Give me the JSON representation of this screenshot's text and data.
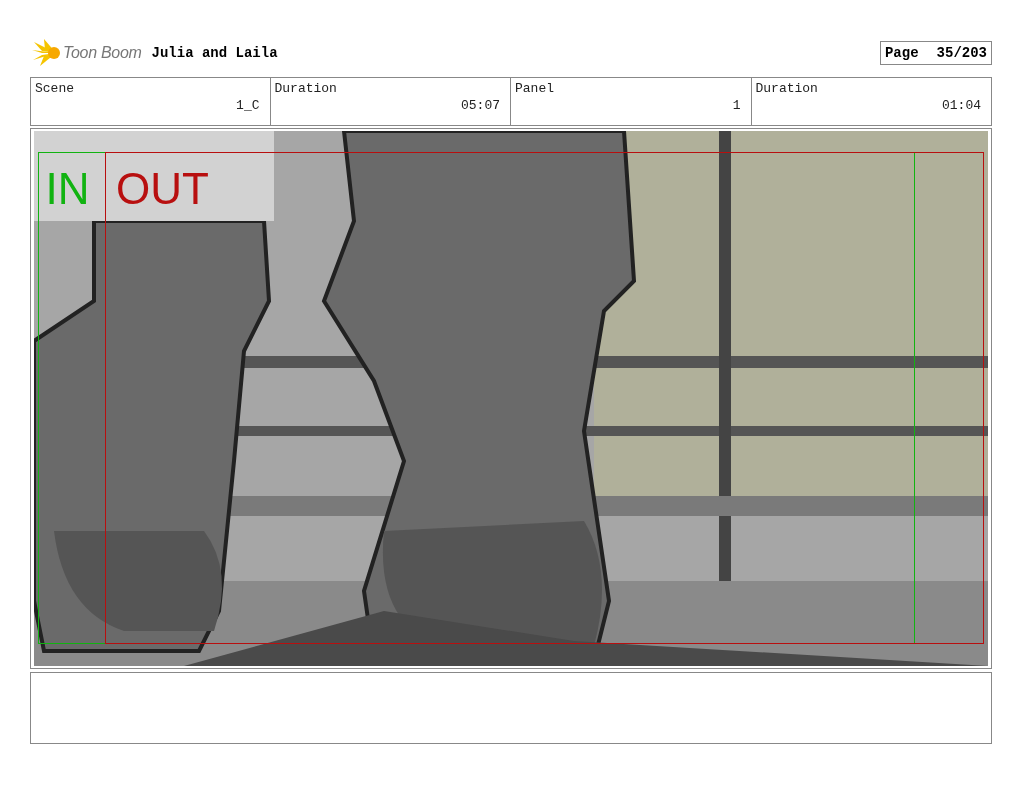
{
  "header": {
    "logo_text": "Toon Boom",
    "title": "Julia and Laila",
    "page_label": "Page",
    "page_number": "35/203"
  },
  "info_fields": [
    {
      "label": "Scene",
      "value": "1_C"
    },
    {
      "label": "Duration",
      "value": "05:07"
    },
    {
      "label": "Panel",
      "value": "1"
    },
    {
      "label": "Duration",
      "value": "01:04"
    }
  ],
  "panel": {
    "frames": [
      {
        "label": "IN",
        "color": "#11b311"
      },
      {
        "label": "OUT",
        "color": "#b80f0f"
      }
    ]
  }
}
